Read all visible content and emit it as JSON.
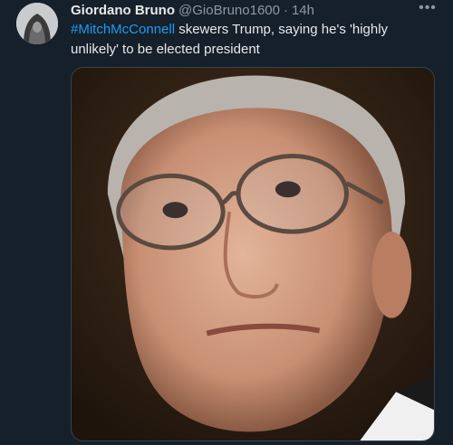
{
  "tweet": {
    "display_name": "Giordano Bruno",
    "handle": "@GioBruno1600",
    "separator": "·",
    "time": "14h",
    "hashtag": "#MitchMcConnell",
    "text": " skewers Trump, saying he's 'highly unlikely' to be elected president"
  },
  "icons": {
    "more": "more-horizontal-icon"
  },
  "colors": {
    "background": "#15202b",
    "link": "#1d9bf0",
    "secondary_text": "#8b98a5"
  }
}
